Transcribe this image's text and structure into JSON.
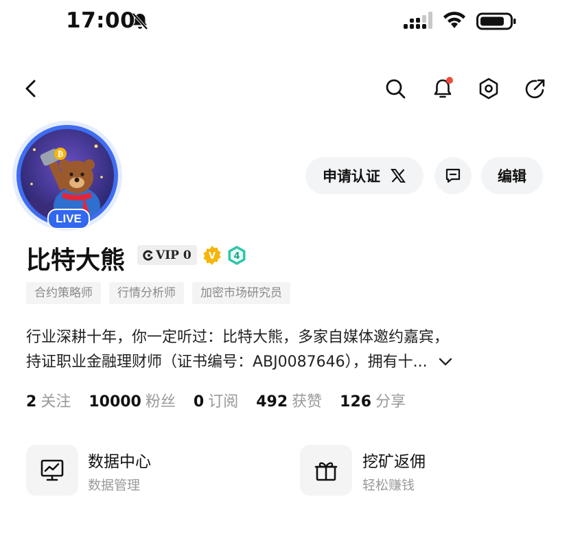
{
  "status_bar": {
    "time": "17:00"
  },
  "profile": {
    "name": "比特大熊",
    "live_badge": "LIVE",
    "vip_label": "VIP 0",
    "badge_v": "V",
    "badge_level": "4",
    "tags": [
      "合约策略师",
      "行情分析师",
      "加密市场研究员"
    ],
    "bio_line1": "行业深耕十年，你一定听过：比特大熊，多家自媒体邀约嘉宾，",
    "bio_line2": "持证职业金融理财师（证书编号：ABJ0087646），拥有十..."
  },
  "actions": {
    "verify_label": "申请认证",
    "edit_label": "编辑"
  },
  "stats": [
    {
      "value": "2",
      "label": "关注"
    },
    {
      "value": "10000",
      "label": "粉丝"
    },
    {
      "value": "0",
      "label": "订阅"
    },
    {
      "value": "492",
      "label": "获赞"
    },
    {
      "value": "126",
      "label": "分享"
    }
  ],
  "cards": [
    {
      "title": "数据中心",
      "subtitle": "数据管理",
      "icon": "chart-monitor-icon"
    },
    {
      "title": "挖矿返佣",
      "subtitle": "轻松赚钱",
      "icon": "gift-icon"
    }
  ],
  "colors": {
    "accent": "#3267f0",
    "notification_dot": "#f04a3c",
    "badge_gold": "#f5b50a",
    "badge_teal": "#2fc6a8"
  }
}
